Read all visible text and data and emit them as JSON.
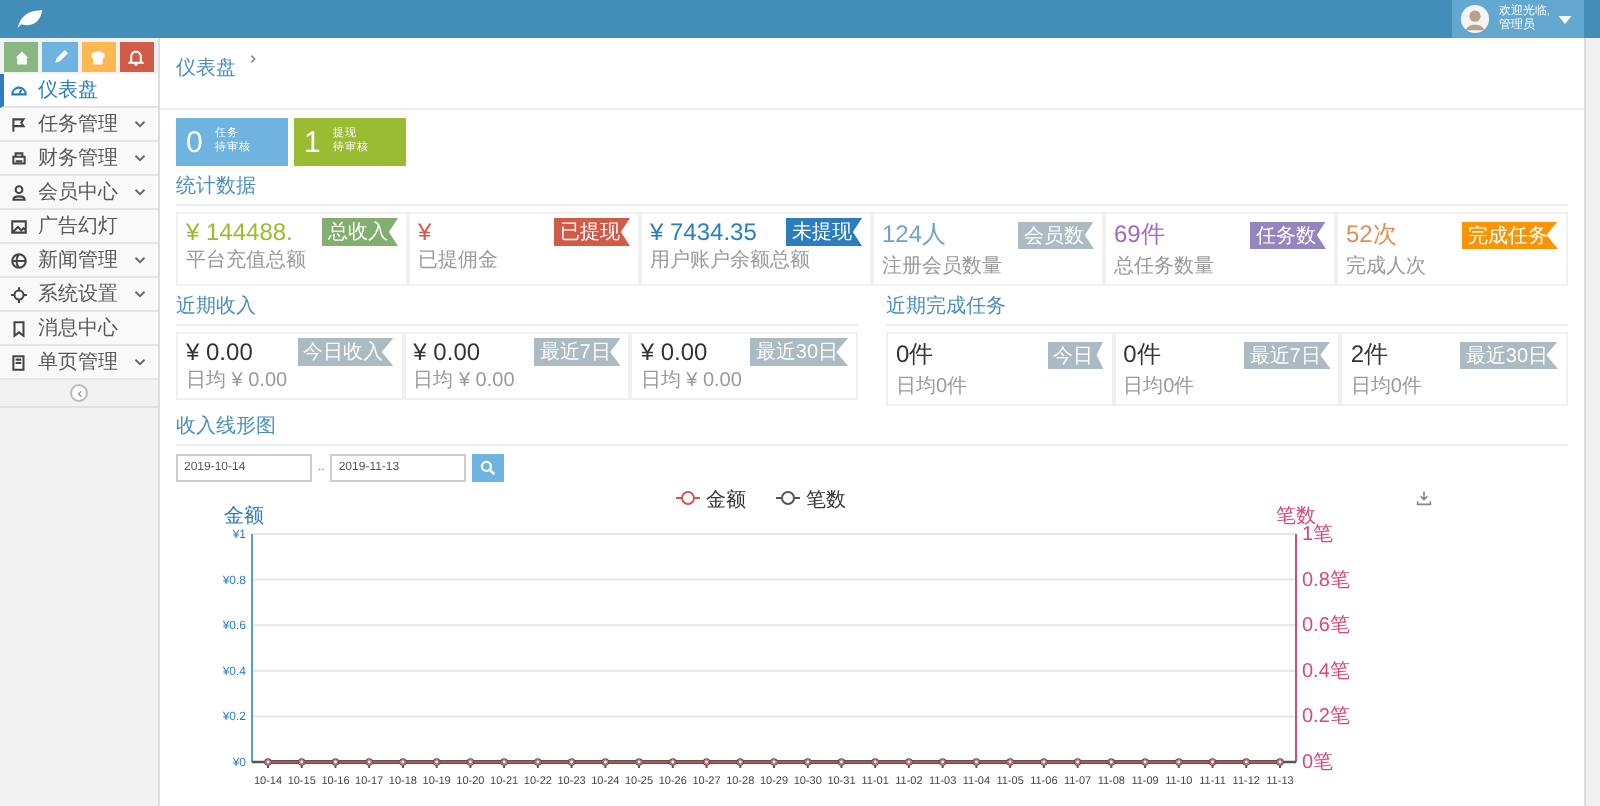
{
  "header": {
    "welcome": "欢迎光临,",
    "user": "管理员"
  },
  "shortcuts": [
    {
      "color": "#87b87f"
    },
    {
      "color": "#6fb3e0"
    },
    {
      "color": "#ffb752"
    },
    {
      "color": "#d15b47"
    }
  ],
  "sidebar": {
    "items": [
      {
        "label": "仪表盘",
        "selected": true,
        "has_submenu": false
      },
      {
        "label": "任务管理",
        "selected": false,
        "has_submenu": true
      },
      {
        "label": "财务管理",
        "selected": false,
        "has_submenu": true
      },
      {
        "label": "会员中心",
        "selected": false,
        "has_submenu": true
      },
      {
        "label": "广告幻灯",
        "selected": false,
        "has_submenu": false
      },
      {
        "label": "新闻管理",
        "selected": false,
        "has_submenu": true
      },
      {
        "label": "系统设置",
        "selected": false,
        "has_submenu": true
      },
      {
        "label": "消息中心",
        "selected": false,
        "has_submenu": false
      },
      {
        "label": "单页管理",
        "selected": false,
        "has_submenu": true
      }
    ]
  },
  "breadcrumb": "仪表盘",
  "pending": [
    {
      "count": "0",
      "title": "任务",
      "sub": "待审核",
      "color": "#6fb3e0"
    },
    {
      "count": "1",
      "title": "提现",
      "sub": "待审核",
      "color": "#9abc32"
    }
  ],
  "stats": {
    "title": "统计数据",
    "cards": [
      {
        "value": "¥ 144488.",
        "label": "平台充值总额",
        "badge": {
          "text": "总收入",
          "color": "#82af6f"
        },
        "color": "#9abc32"
      },
      {
        "value": "¥",
        "label": "已提佣金",
        "badge": {
          "text": "已提现",
          "color": "#d15b47"
        },
        "color": "#d15b47"
      },
      {
        "value": "¥ 7434.35",
        "label": "用户账户余额总额",
        "badge": {
          "text": "未提现",
          "color": "#2b7dbc"
        },
        "color": "#2b7dbc"
      },
      {
        "value": "124人",
        "label": "注册会员数量",
        "badge": {
          "text": "会员数",
          "color": "#abbac3"
        },
        "color": "#6fa2d1"
      },
      {
        "value": "69件",
        "label": "总任务数量",
        "badge": {
          "text": "任务数",
          "color": "#9585bf"
        },
        "color": "#a069c3"
      },
      {
        "value": "52次",
        "label": "完成人次",
        "badge": {
          "text": "完成任务",
          "color": "#f89406"
        },
        "color": "#e08e56"
      }
    ]
  },
  "recent_income": {
    "title": "近期收入",
    "cards": [
      {
        "value": "¥ 0.00",
        "label": "日均 ¥ 0.00",
        "badge": "今日收入"
      },
      {
        "value": "¥ 0.00",
        "label": "日均 ¥ 0.00",
        "badge": "最近7日"
      },
      {
        "value": "¥ 0.00",
        "label": "日均 ¥ 0.00",
        "badge": "最近30日"
      }
    ]
  },
  "recent_tasks": {
    "title": "近期完成任务",
    "cards": [
      {
        "value": "0件",
        "label": "日均0件",
        "badge": "今日"
      },
      {
        "value": "0件",
        "label": "日均0件",
        "badge": "最近7日"
      },
      {
        "value": "2件",
        "label": "日均0件",
        "badge": "最近30日"
      }
    ]
  },
  "income_chart": {
    "title": "收入线形图",
    "start_date": "2019-10-14",
    "separator": "..",
    "end_date": "2019-11-13",
    "right_axis": {
      "label": "笔数",
      "ticks": [
        "1笔",
        "0.8笔",
        "0.6笔",
        "0.4笔",
        "0.2笔",
        "0笔"
      ]
    },
    "chart_data": {
      "type": "line",
      "ylabel": "金额",
      "grid": true,
      "legend": true,
      "categories": [
        "10-14",
        "10-15",
        "10-16",
        "10-17",
        "10-18",
        "10-19",
        "10-20",
        "10-21",
        "10-22",
        "10-23",
        "10-24",
        "10-25",
        "10-26",
        "10-27",
        "10-28",
        "10-29",
        "10-30",
        "10-31",
        "11-01",
        "11-02",
        "11-03",
        "11-04",
        "11-05",
        "11-06",
        "11-07",
        "11-08",
        "11-09",
        "11-10",
        "11-11",
        "11-12",
        "11-13"
      ],
      "series": [
        {
          "name": "金额",
          "color": "#d9534f",
          "marker": "circle",
          "values": [
            0,
            0,
            0,
            0,
            0,
            0,
            0,
            0,
            0,
            0,
            0,
            0,
            0,
            0,
            0,
            0,
            0,
            0,
            0,
            0,
            0,
            0,
            0,
            0,
            0,
            0,
            0,
            0,
            0,
            0,
            0
          ]
        },
        {
          "name": "笔数",
          "color": "#555555",
          "marker": "circle",
          "values": [
            0,
            0,
            0,
            0,
            0,
            0,
            0,
            0,
            0,
            0,
            0,
            0,
            0,
            0,
            0,
            0,
            0,
            0,
            0,
            0,
            0,
            0,
            0,
            0,
            0,
            0,
            0,
            0,
            0,
            0,
            0
          ]
        }
      ],
      "ylim": [
        0,
        1
      ],
      "yticks": [
        {
          "value": 0,
          "label": "¥0"
        },
        {
          "value": 0.2,
          "label": "¥0.2"
        },
        {
          "value": 0.4,
          "label": "¥0.4"
        },
        {
          "value": 0.6,
          "label": "¥0.6"
        },
        {
          "value": 0.8,
          "label": "¥0.8"
        },
        {
          "value": 1,
          "label": "¥1"
        }
      ]
    }
  }
}
